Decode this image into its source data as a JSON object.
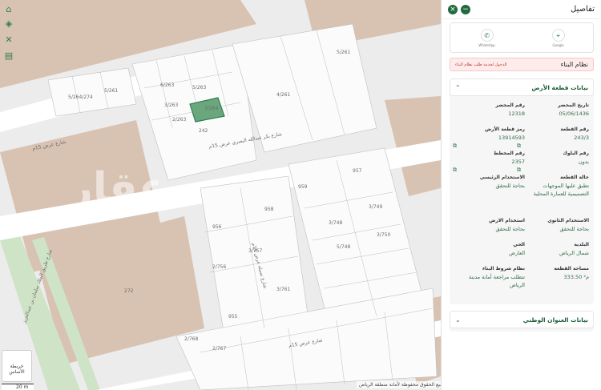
{
  "panel": {
    "title": "تفاصيل",
    "share": {
      "google": "Google",
      "whatsapp": "WhatsApp"
    },
    "build_system": {
      "title": "نظام البناء",
      "link": "الدخول لخدمة طلب نظام البناء"
    },
    "land_card": {
      "title": "بيانات قطعة الأرض",
      "fields": {
        "report_date_k": "تاريخ المحضر",
        "report_date_v": "05/06/1436",
        "report_no_k": "رقم المحضر",
        "report_no_v": "12318",
        "parcel_no_k": "رقم القطعة",
        "parcel_no_v": "243/3",
        "land_code_k": "رمز قطعة الأرض",
        "land_code_v": "13914593",
        "block_no_k": "رقم البلوك",
        "block_no_v": "بدون",
        "plan_no_k": "رقم المخطط",
        "plan_no_v": "2357",
        "parcel_status_k": "حالة القطعة",
        "parcel_status_v": "تطبق عليها الموجهات التصميمية للعمارة المحلية",
        "main_use_k": "الاستخدام الرئيسي",
        "main_use_v": "بحاجة للتحقق",
        "sub_use_k": "الاستخدام الثانوي",
        "sub_use_v": "بحاجة للتحقق",
        "land_use_k": "استخدام الارض",
        "land_use_v": "بحاجة للتحقق",
        "municipality_k": "البلدية",
        "municipality_v": "شمال الرياض",
        "district_k": "الحي",
        "district_v": "العارض",
        "area_k": "مساحة القطعة",
        "area_v": "333.50 م²",
        "build_cond_k": "نظام شروط البناء",
        "build_cond_v": "تتطلب مراجعة أمانة مدينة الرياض"
      }
    },
    "address_card": {
      "title": "بيانات العنوان الوطني"
    }
  },
  "map": {
    "basemap_label": "خريطة الأساس",
    "scale_label": "20 m",
    "footer": "جميع الحقوق محفوظة لأمانة منطقة الرياض",
    "watermark": "عقار",
    "watermark_sub": "sa",
    "labels": {
      "l1": "5/261",
      "l2": "4/261",
      "l3": "5/263",
      "l4": "3/263",
      "l5": "6/263",
      "l6": "3/264",
      "l7": "242",
      "l8": "5/264/274",
      "l9": "2/263",
      "l10": "5/261",
      "l11": "شارع بكر عبدالله البصري عرض 15م",
      "l12": "شارع عرض 15م",
      "l13": "272",
      "l14": "956",
      "l15": "958",
      "l16": "959",
      "l17": "957",
      "l18": "3/748",
      "l19": "3/749",
      "l20": "3/750",
      "l21": "5/748",
      "l22": "3/757",
      "l23": "3/761",
      "l24": "2/756",
      "l25": "955",
      "l26": "شارع عرض 15م",
      "l27": "2/768",
      "l28": "2/767",
      "l29": "شارع طريق الملك سلمان بن عبدالعزيز",
      "l30": "شارع نسيلة عرض 15م"
    }
  }
}
